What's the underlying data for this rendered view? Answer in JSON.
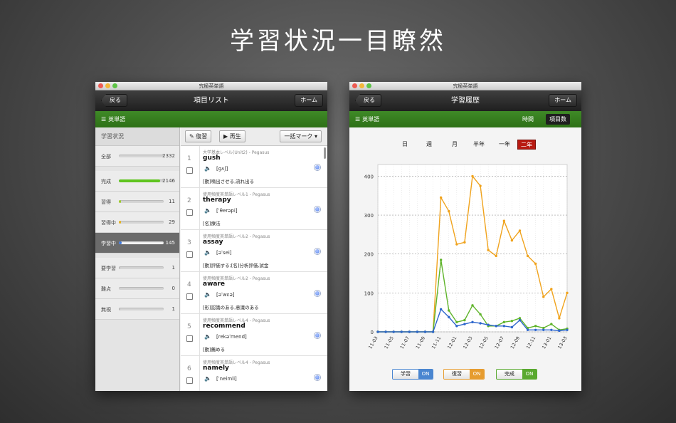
{
  "headline": "学習状況一目瞭然",
  "colors": {
    "green_header": "#2d7016",
    "study": "#2e66cc",
    "review": "#f0a31d",
    "done": "#5fb42a",
    "selected_range": "#b81a12"
  },
  "left_window": {
    "title": "究極英単語",
    "nav": {
      "back": "戻る",
      "title": "項目リスト",
      "home": "ホーム"
    },
    "header_label": "英単語",
    "sidebar": {
      "heading": "学習状況",
      "rows": [
        {
          "label": "全部",
          "count": "2332",
          "fill": 0,
          "color": "#cccccc",
          "active": false,
          "gap": false
        },
        {
          "label": "完成",
          "count": "2146",
          "fill": 0.92,
          "color": "#5fc41f",
          "active": false,
          "gap": true
        },
        {
          "label": "習得",
          "count": "11",
          "fill": 0.05,
          "color": "#9ccc2a",
          "active": false,
          "gap": false
        },
        {
          "label": "習得中",
          "count": "29",
          "fill": 0.05,
          "color": "#e7b31d",
          "active": false,
          "gap": false
        },
        {
          "label": "学習中",
          "count": "145",
          "fill": 0.06,
          "color": "#3d78dd",
          "active": true,
          "gap": false
        },
        {
          "label": "要学習",
          "count": "1",
          "fill": 0.03,
          "color": "#bdbdbd",
          "active": false,
          "gap": true
        },
        {
          "label": "難点",
          "count": "0",
          "fill": 0,
          "color": "#bdbdbd",
          "active": false,
          "gap": false
        },
        {
          "label": "無視",
          "count": "1",
          "fill": 0.03,
          "color": "#bdbdbd",
          "active": false,
          "gap": false
        }
      ]
    },
    "toolbar": {
      "review": "復習",
      "play": "再生",
      "bulk_mark": "一括マーク"
    },
    "items": [
      {
        "num": "1",
        "source": "大学基本レベル(Unit2) - Pegasus",
        "word": "gush",
        "pron": "[gʌʃ]",
        "meaning": "[動]噴出させる,流れ出る"
      },
      {
        "num": "2",
        "source": "使用頻度英単語レベル1 - Pegasus",
        "word": "therapy",
        "pron": "[ˈθerəpi]",
        "meaning": "[名]療法"
      },
      {
        "num": "3",
        "source": "使用頻度英単語レベル2 - Pegasus",
        "word": "assay",
        "pron": "[əˈsei]",
        "meaning": "[動]評価する;[名]分析評価,試金"
      },
      {
        "num": "4",
        "source": "使用頻度英単語レベル2 - Pegasus",
        "word": "aware",
        "pron": "[əˈwɛə]",
        "meaning": "[形]認識のある,意識のある"
      },
      {
        "num": "5",
        "source": "使用頻度英単語レベル4 - Pegasus",
        "word": "recommend",
        "pron": "[rekəˈmend]",
        "meaning": "[動]薦める"
      },
      {
        "num": "6",
        "source": "使用頻度英単語レベル4 - Pegasus",
        "word": "namely",
        "pron": "[ˈneimli]",
        "meaning": ""
      }
    ]
  },
  "right_window": {
    "title": "究極英単語",
    "nav": {
      "back": "戻る",
      "title": "学習履歴",
      "home": "ホーム"
    },
    "header_label": "英単語",
    "segments": [
      {
        "label": "時間",
        "active": false
      },
      {
        "label": "項目数",
        "active": true
      }
    ],
    "range_tabs": [
      {
        "label": "日",
        "active": false
      },
      {
        "label": "週",
        "active": false
      },
      {
        "label": "月",
        "active": false
      },
      {
        "label": "半年",
        "active": false
      },
      {
        "label": "一年",
        "active": false
      },
      {
        "label": "二年",
        "active": true
      }
    ],
    "toggles": [
      {
        "label": "学習",
        "state": "ON",
        "color": "#4a86d0"
      },
      {
        "label": "復習",
        "state": "ON",
        "color": "#e69c2f"
      },
      {
        "label": "完成",
        "state": "ON",
        "color": "#59a92f"
      }
    ]
  },
  "chart_data": {
    "type": "line",
    "ylim": [
      0,
      430
    ],
    "yticks": [
      0,
      100,
      200,
      300,
      400
    ],
    "x": [
      "11-03",
      "11-04",
      "11-05",
      "11-06",
      "11-07",
      "11-08",
      "11-09",
      "11-10",
      "11-11",
      "11-12",
      "12-01",
      "12-02",
      "12-03",
      "12-04",
      "12-05",
      "12-06",
      "12-07",
      "12-08",
      "12-09",
      "12-10",
      "12-11",
      "12-12",
      "13-01",
      "13-02",
      "13-03"
    ],
    "xticks": [
      "11-03",
      "11-05",
      "11-07",
      "11-09",
      "11-11",
      "12-01",
      "12-03",
      "12-05",
      "12-07",
      "12-09",
      "12-11",
      "13-01",
      "13-03"
    ],
    "series": [
      {
        "name": "復習",
        "color": "#f0a31d",
        "values": [
          0,
          0,
          0,
          0,
          0,
          0,
          0,
          0,
          345,
          310,
          225,
          230,
          400,
          375,
          210,
          195,
          285,
          235,
          260,
          195,
          175,
          90,
          110,
          35,
          100
        ]
      },
      {
        "name": "完成",
        "color": "#5fb42a",
        "values": [
          0,
          0,
          0,
          0,
          0,
          0,
          0,
          0,
          185,
          55,
          25,
          30,
          68,
          45,
          15,
          15,
          25,
          28,
          35,
          10,
          15,
          10,
          20,
          5,
          8
        ]
      },
      {
        "name": "学習",
        "color": "#2e66cc",
        "values": [
          0,
          0,
          0,
          0,
          0,
          0,
          0,
          0,
          58,
          38,
          15,
          20,
          25,
          22,
          18,
          15,
          15,
          12,
          30,
          5,
          5,
          5,
          5,
          3,
          5
        ]
      }
    ]
  }
}
